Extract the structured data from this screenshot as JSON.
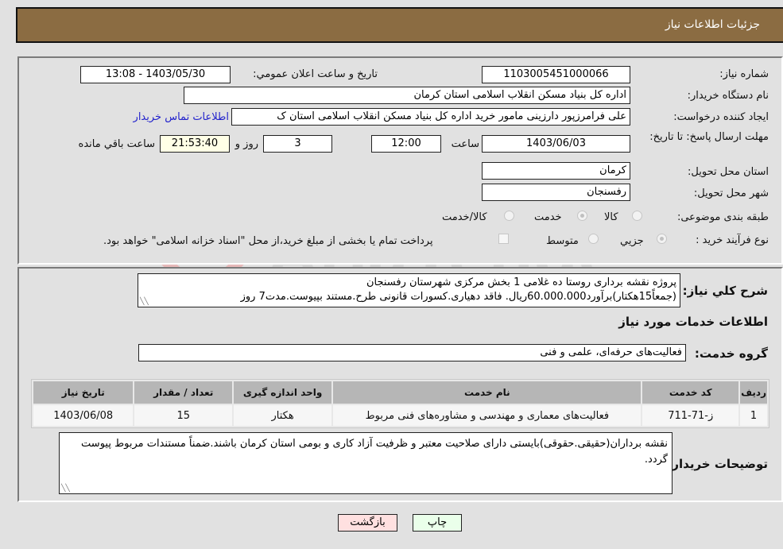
{
  "header": {
    "title": "جزئیات اطلاعات نیاز"
  },
  "fields": {
    "need_number": {
      "label": "شماره نیاز:",
      "value": "1103005451000066"
    },
    "announce_datetime": {
      "label": "تاریخ و ساعت اعلان عمومي:",
      "value": "1403/05/30 - 13:08"
    },
    "buyer_org": {
      "label": "نام دستگاه خریدار:",
      "value": "اداره کل بنیاد مسکن انقلاب اسلامی استان کرمان"
    },
    "requester": {
      "label": "ایجاد کننده درخواست:",
      "value": "علی فرامرزپور دارزینی مامور خرید اداره کل بنیاد مسکن انقلاب اسلامی استان ک"
    },
    "buyer_contact_link": "اطلاعات تماس خریدار",
    "deadline": {
      "label": "مهلت ارسال پاسخ: تا تاریخ:",
      "date": "1403/06/03",
      "time_label": "ساعت",
      "time": "12:00",
      "days": "3",
      "days_label": "روز و",
      "remaining": "21:53:40",
      "remaining_label": "ساعت باقي مانده"
    },
    "delivery_province": {
      "label": "استان محل تحویل:",
      "value": "کرمان"
    },
    "delivery_city": {
      "label": "شهر محل تحویل:",
      "value": "رفسنجان"
    },
    "category": {
      "label": "طبقه بندی موضوعی:",
      "options": [
        "کالا",
        "خدمت",
        "کالا/خدمت"
      ],
      "selected": "خدمت"
    },
    "purchase_type": {
      "label": "نوع فرآیند خرید :",
      "options": [
        "جزيي",
        "متوسط"
      ],
      "selected": "جزيي",
      "treasury_note": "پرداخت تمام یا بخشی از مبلغ خرید،از محل \"اسناد خزانه اسلامی\" خواهد بود."
    }
  },
  "description": {
    "label": "شرح كلي نياز:",
    "line1": "پروژه نقشه برداری  روستا ده غلامی 1 بخش مرکزی شهرستان رفسنجان",
    "line2": "(جمعاً15هکتار)برآورد60.000.000ریال. فاقد دهیاری.کسورات قانونی طرح.مستند بپیوست.مدت7 روز"
  },
  "services": {
    "section_title": "اطلاعات خدمات مورد نیاز",
    "group_label": "گروه خدمت:",
    "group_value": "فعالیت‌های حرفه‌ای، علمی و فنی",
    "columns": [
      "ردیف",
      "کد خدمت",
      "نام خدمت",
      "واحد اندازه گیری",
      "تعداد / مقدار",
      "تاریخ نیاز"
    ],
    "rows": [
      [
        "1",
        "ز-71-711",
        "فعالیت‌های معماری و مهندسی و مشاوره‌های فنی مربوط",
        "هکتار",
        "15",
        "1403/06/08"
      ]
    ]
  },
  "buyer_notes": {
    "label": "توضیحات خریدار:",
    "text": "نقشه برداران(حقیقی.حقوقی)بایستی دارای صلاحیت معتبر و ظرفیت آزاد کاری و بومی استان کرمان باشند.ضمناً مستندات مربوط پیوست گردد."
  },
  "buttons": {
    "print": "چاپ",
    "back": "بازگشت"
  },
  "watermark": {
    "text": "AriaTender.neT"
  },
  "colors": {
    "header_bg": "#8b6c42",
    "page_bg": "#e1e1e1",
    "link": "#2222cc",
    "remaining_bg": "#ffffe6",
    "back_btn": "#ffe0e0",
    "print_btn": "#eaffea"
  }
}
